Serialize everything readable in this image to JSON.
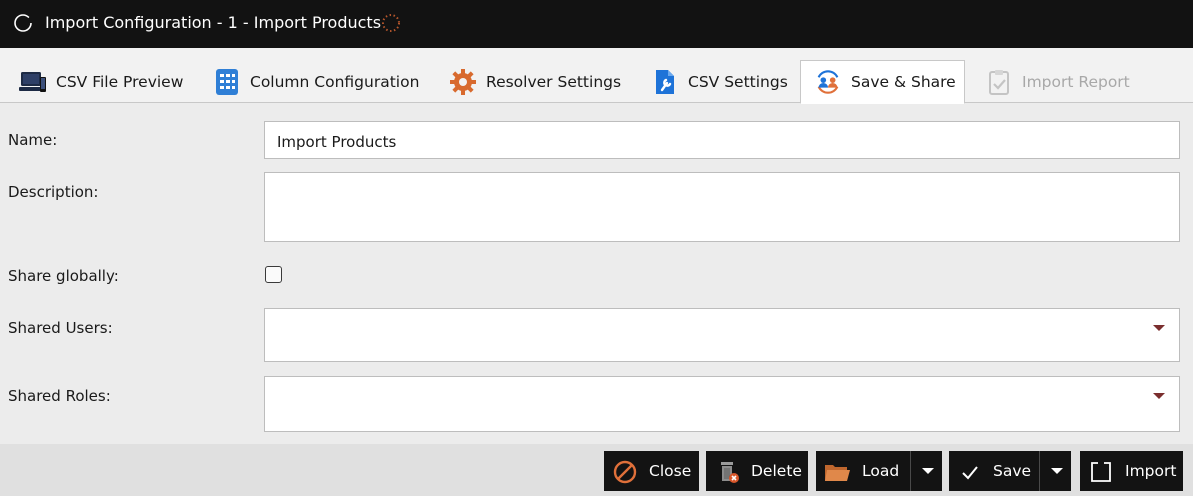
{
  "window": {
    "title": "Import Configuration - 1 - Import Products"
  },
  "tabs": [
    {
      "label": "CSV File Preview",
      "icon": "computer-icon"
    },
    {
      "label": "Column Configuration",
      "icon": "grid-icon"
    },
    {
      "label": "Resolver Settings",
      "icon": "gear-icon"
    },
    {
      "label": "CSV Settings",
      "icon": "wrench-document-icon"
    },
    {
      "label": "Save & Share",
      "icon": "users-share-icon",
      "active": true
    },
    {
      "label": "Import Report",
      "icon": "clipboard-check-icon",
      "disabled": true
    }
  ],
  "form": {
    "name_label": "Name:",
    "name_value": "Import Products",
    "description_label": "Description:",
    "description_value": "",
    "share_globally_label": "Share globally:",
    "share_globally_checked": false,
    "shared_users_label": "Shared Users:",
    "shared_roles_label": "Shared Roles:"
  },
  "buttons": {
    "close": "Close",
    "delete": "Delete",
    "load": "Load",
    "save": "Save",
    "import": "Import"
  },
  "colors": {
    "titlebar_bg": "#121212",
    "button_bg": "#131313",
    "accent_orange": "#e0703a",
    "accent_blue": "#1e73d8",
    "dropdown_caret": "#7a2e2e"
  }
}
